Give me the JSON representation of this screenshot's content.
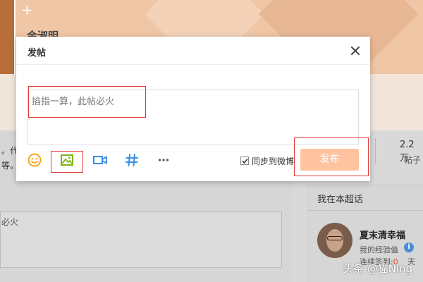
{
  "background": {
    "group_title": "金淑明",
    "post_line1": "。代",
    "post_line2": "等。",
    "input_preview": "必火",
    "stat_value": "2.2万",
    "stat_label": "帖子",
    "supertopic_title": "我在本超话",
    "username": "夏末清幸福",
    "exp_label": "我的经验值",
    "exp_info_icon": "i",
    "streak_label": "连续签到:",
    "streak_value": "0",
    "streak_unit": "天"
  },
  "modal": {
    "title": "发帖",
    "placeholder": "掐指一算，此帖必火",
    "sync_label": "同步到微博",
    "sync_checked": true,
    "publish_label": "发布",
    "publish_color": "#ffc3a0"
  },
  "toolbar": {
    "icons": [
      "emoji-icon",
      "image-icon",
      "video-icon",
      "topic-hashtag-icon",
      "more-icon"
    ]
  },
  "watermark": "头条 @猫Ning",
  "colors": {
    "accent_orange": "#f5a623",
    "image_icon_green": "#7cb518",
    "video_icon_blue": "#3b8fe0",
    "highlight_red": "#e53935"
  }
}
